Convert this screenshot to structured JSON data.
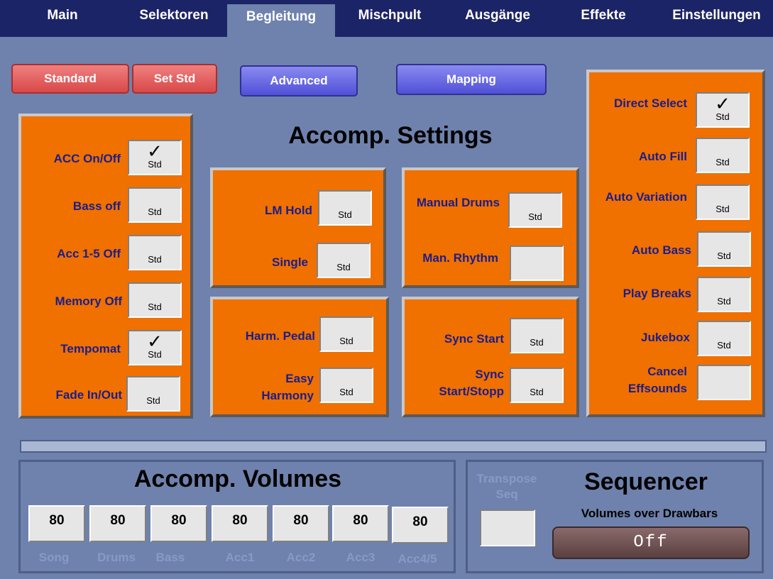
{
  "tabs": [
    "Main",
    "Selektoren",
    "Begleitung",
    "Mischpult",
    "Ausgänge",
    "Effekte",
    "Einstellungen"
  ],
  "buttons": {
    "standard": "Standard",
    "set_std": "Set Std",
    "advanced": "Advanced",
    "mapping": "Mapping"
  },
  "main_title": "Accomp. Settings",
  "std": "Std",
  "check": "✓",
  "left_panel": [
    {
      "label": "ACC On/Off",
      "checked": true
    },
    {
      "label": "Bass off",
      "checked": false
    },
    {
      "label": "Acc 1-5 Off",
      "checked": false
    },
    {
      "label": "Memory Off",
      "checked": false
    },
    {
      "label": "Tempomat",
      "checked": true
    },
    {
      "label": "Fade In/Out",
      "checked": false
    }
  ],
  "mid_panel_1": [
    {
      "label": "LM Hold"
    },
    {
      "label": "Single"
    }
  ],
  "mid_panel_2": [
    {
      "label": "Manual Drums"
    },
    {
      "label": "Man. Rhythm"
    }
  ],
  "mid_panel_3": [
    {
      "label": "Harm. Pedal"
    },
    {
      "label": "Easy Harmony"
    }
  ],
  "mid_panel_4": [
    {
      "label": "Sync Start"
    },
    {
      "label": "Sync Start/Stopp"
    }
  ],
  "right_panel": [
    {
      "label": "Direct Select",
      "checked": true
    },
    {
      "label": "Auto Fill",
      "checked": false
    },
    {
      "label": "Auto Variation",
      "checked": false
    },
    {
      "label": "Auto Bass",
      "checked": false
    },
    {
      "label": "Play Breaks",
      "checked": false
    },
    {
      "label": "Jukebox",
      "checked": false
    },
    {
      "label": "Cancel Effsounds",
      "checked": false
    }
  ],
  "volumes": {
    "title": "Accomp. Volumes",
    "channels": [
      {
        "label": "Song",
        "value": "80"
      },
      {
        "label": "Drums",
        "value": "80"
      },
      {
        "label": "Bass",
        "value": "80"
      },
      {
        "label": "Acc1",
        "value": "80"
      },
      {
        "label": "Acc2",
        "value": "80"
      },
      {
        "label": "Acc3",
        "value": "80"
      },
      {
        "label": "Acc4/5",
        "value": "80"
      }
    ]
  },
  "sequencer": {
    "title": "Sequencer",
    "transpose_label": "Transpose Seq",
    "drawbars_label": "Volumes over Drawbars",
    "drawbars_value": "Off"
  },
  "colors": {
    "panel": "#f07000",
    "background": "#6f82ad",
    "tabbar": "#1c2468",
    "label": "#1a1e8a"
  }
}
